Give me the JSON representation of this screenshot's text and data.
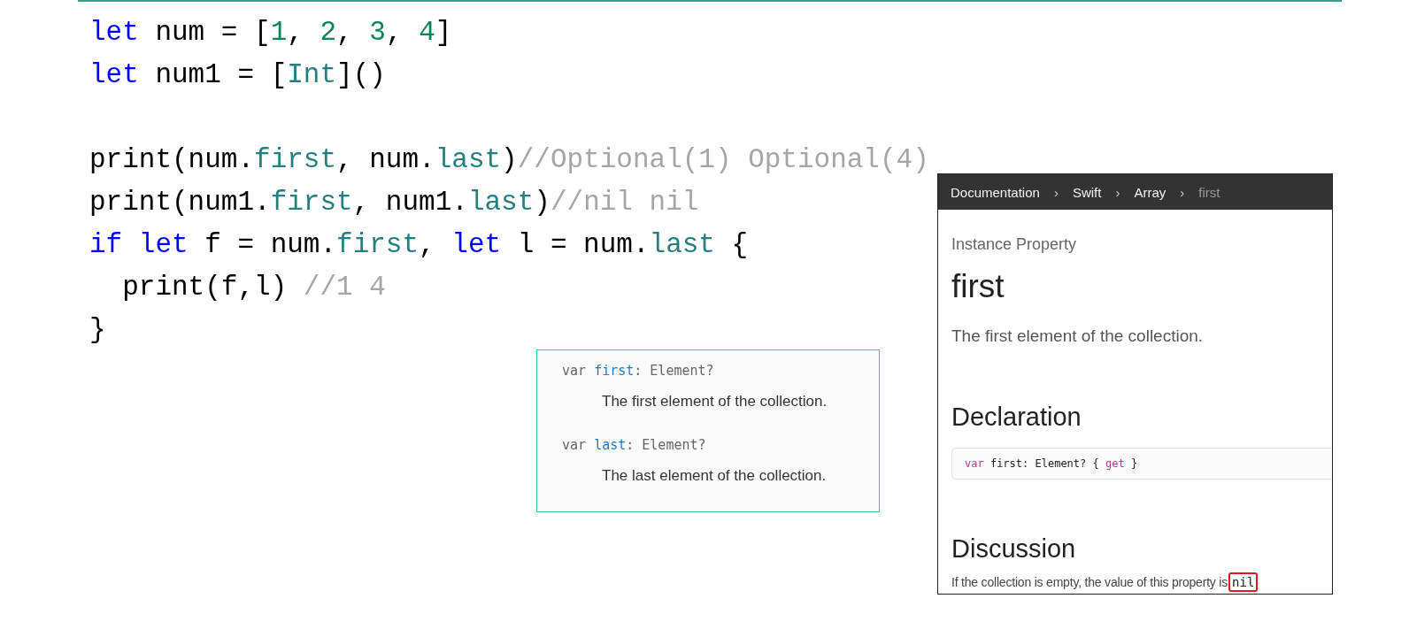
{
  "code": {
    "blocks": [
      [
        [
          {
            "text": "let",
            "kind": "keyword"
          },
          {
            "text": " num = [",
            "kind": "plain"
          },
          {
            "text": "1",
            "kind": "number"
          },
          {
            "text": ", ",
            "kind": "plain"
          },
          {
            "text": "2",
            "kind": "number"
          },
          {
            "text": ", ",
            "kind": "plain"
          },
          {
            "text": "3",
            "kind": "number"
          },
          {
            "text": ", ",
            "kind": "plain"
          },
          {
            "text": "4",
            "kind": "number"
          },
          {
            "text": "]",
            "kind": "plain"
          }
        ],
        [
          {
            "text": "let",
            "kind": "keyword"
          },
          {
            "text": " num1 = [",
            "kind": "plain"
          },
          {
            "text": "Int",
            "kind": "member"
          },
          {
            "text": "]()",
            "kind": "plain"
          }
        ]
      ],
      [
        [
          {
            "text": "print(num.",
            "kind": "plain"
          },
          {
            "text": "first",
            "kind": "member"
          },
          {
            "text": ", num.",
            "kind": "plain"
          },
          {
            "text": "last",
            "kind": "member"
          },
          {
            "text": ")",
            "kind": "plain"
          },
          {
            "text": "//Optional(1) Optional(4)",
            "kind": "comment"
          }
        ],
        [
          {
            "text": "print(num1.",
            "kind": "plain"
          },
          {
            "text": "first",
            "kind": "member"
          },
          {
            "text": ", num1.",
            "kind": "plain"
          },
          {
            "text": "last",
            "kind": "member"
          },
          {
            "text": ")",
            "kind": "plain"
          },
          {
            "text": "//nil nil",
            "kind": "comment"
          }
        ],
        [
          {
            "text": "if let",
            "kind": "keyword"
          },
          {
            "text": " f = num.",
            "kind": "plain"
          },
          {
            "text": "first",
            "kind": "member"
          },
          {
            "text": ", ",
            "kind": "plain"
          },
          {
            "text": "let",
            "kind": "keyword"
          },
          {
            "text": " l = num.",
            "kind": "plain"
          },
          {
            "text": "last",
            "kind": "member"
          },
          {
            "text": " {",
            "kind": "plain"
          }
        ],
        [
          {
            "text": "  print(f,l) ",
            "kind": "plain"
          },
          {
            "text": "//1 4",
            "kind": "comment"
          }
        ],
        [
          {
            "text": "}",
            "kind": "plain"
          }
        ]
      ]
    ]
  },
  "summary_box": {
    "items": [
      {
        "keyword": "var",
        "name": "first",
        "type": ": Element?",
        "description": "The first element of the collection."
      },
      {
        "keyword": "var",
        "name": "last",
        "type": ": Element?",
        "description": "The last element of the collection."
      }
    ]
  },
  "doc_page": {
    "breadcrumbs": [
      {
        "label": "Documentation",
        "current": false
      },
      {
        "label": "Swift",
        "current": false
      },
      {
        "label": "Array",
        "current": false
      },
      {
        "label": "first",
        "current": true
      }
    ],
    "separator": "›",
    "eyebrow": "Instance Property",
    "title": "first",
    "abstract": "The first element of the collection.",
    "declaration_heading": "Declaration",
    "declaration": [
      {
        "text": "var",
        "kind": "keyword"
      },
      {
        "text": " first: Element? { ",
        "kind": "plain"
      },
      {
        "text": "get",
        "kind": "keyword"
      },
      {
        "text": " }",
        "kind": "plain"
      }
    ],
    "discussion_heading": "Discussion",
    "discussion": [
      {
        "text": "If the collection is empty, the value of this property is",
        "kind": "text"
      },
      {
        "text": "nil",
        "kind": "code",
        "highlighted": true
      }
    ]
  }
}
